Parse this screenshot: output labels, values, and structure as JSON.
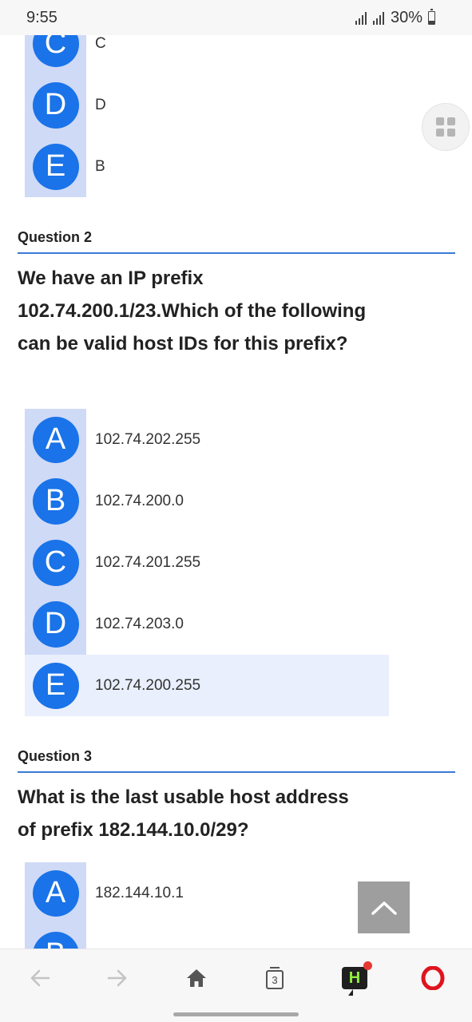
{
  "status_bar": {
    "time": "9:55",
    "battery": "30%"
  },
  "question1_tail": {
    "options": [
      {
        "letter": "C",
        "text": "C"
      },
      {
        "letter": "D",
        "text": "D"
      },
      {
        "letter": "E",
        "text": "B"
      }
    ]
  },
  "question2": {
    "label": "Question 2",
    "text": "We have an IP prefix 102.74.200.1/23.Which of the following can be valid host IDs for this prefix?",
    "options": [
      {
        "letter": "A",
        "text": "102.74.202.255"
      },
      {
        "letter": "B",
        "text": "102.74.200.0"
      },
      {
        "letter": "C",
        "text": "102.74.201.255"
      },
      {
        "letter": "D",
        "text": "102.74.203.0"
      },
      {
        "letter": "E",
        "text": "102.74.200.255"
      }
    ]
  },
  "question3": {
    "label": "Question 3",
    "text": "What is the last usable host address of prefix 182.144.10.0/29?",
    "options": [
      {
        "letter": "A",
        "text": "182.144.10.1"
      },
      {
        "letter": "B",
        "text": ""
      }
    ]
  },
  "bottom_nav": {
    "tab_count": "3",
    "icons": [
      "back-arrow-icon",
      "forward-arrow-icon",
      "home-icon",
      "tabs-icon",
      "hype-chat-icon",
      "opera-icon"
    ]
  },
  "colors": {
    "accent": "#1a73e8",
    "letter_column": "#cfdaf7",
    "selected_row": "#e9effd",
    "rule": "#3a7bd5",
    "opera_red": "#e0141e"
  }
}
